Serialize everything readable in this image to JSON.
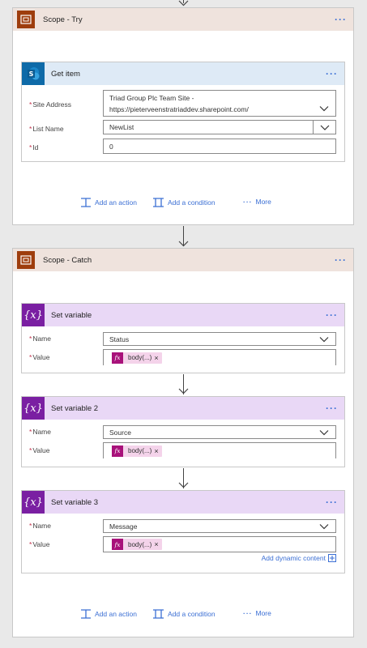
{
  "scope_try": {
    "title": "Scope - Try",
    "get_item": {
      "title": "Get item",
      "site_address_label": "Site Address",
      "site_address_line1": "Triad Group Plc Team Site -",
      "site_address_line2": "https://pieterveenstratriaddev.sharepoint.com/",
      "list_name_label": "List Name",
      "list_name_value": "NewList",
      "id_label": "Id",
      "id_value": "0"
    },
    "footer": {
      "add_action": "Add an action",
      "add_condition": "Add a condition",
      "more": "More"
    }
  },
  "scope_catch": {
    "title": "Scope - Catch",
    "actions": [
      {
        "title": "Set variable",
        "name_label": "Name",
        "name_value": "Status",
        "value_label": "Value",
        "token": "body(...)"
      },
      {
        "title": "Set variable 2",
        "name_label": "Name",
        "name_value": "Source",
        "value_label": "Value",
        "token": "body(...)"
      },
      {
        "title": "Set variable 3",
        "name_label": "Name",
        "name_value": "Message",
        "value_label": "Value",
        "token": "body(...)"
      }
    ],
    "add_dynamic_content": "Add dynamic content",
    "footer": {
      "add_action": "Add an action",
      "add_condition": "Add a condition",
      "more": "More"
    }
  },
  "icons": {
    "scope": "scope-icon",
    "sharepoint": "sharepoint-icon",
    "variable": "variable-icon",
    "expression": "fx-icon",
    "more": "ellipsis-icon"
  },
  "colors": {
    "accent_link": "#3b6fd4",
    "scope_brand": "#9e3d0d",
    "sharepoint_brand": "#0e6aa8",
    "variable_brand": "#7a1fa2",
    "expression_token": "#a8117a"
  }
}
